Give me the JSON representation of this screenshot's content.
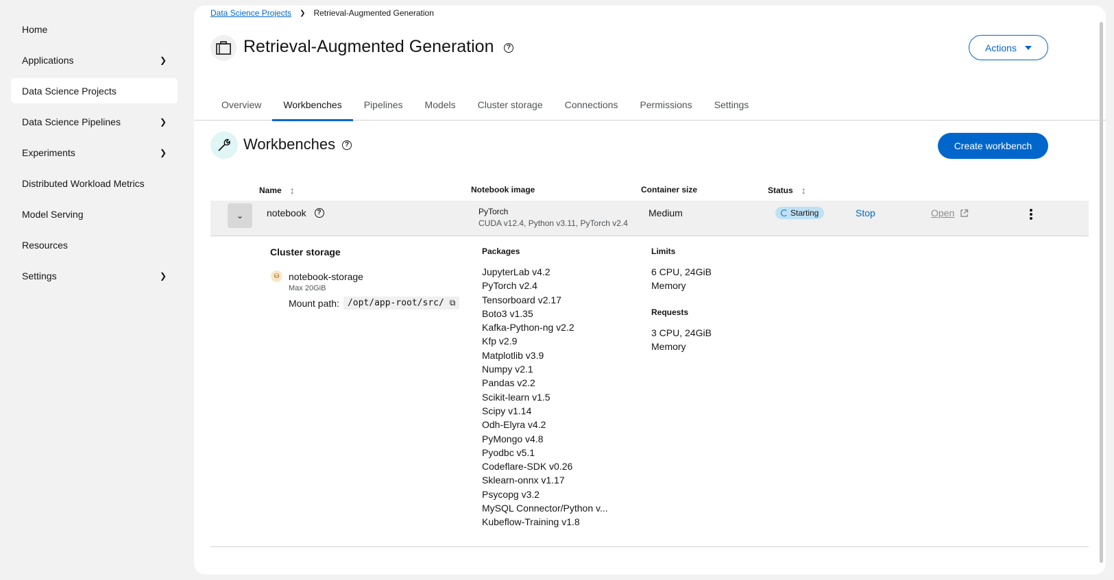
{
  "sidebar": {
    "items": [
      {
        "label": "Home",
        "chevron": false,
        "active": false
      },
      {
        "label": "Applications",
        "chevron": true,
        "active": false
      },
      {
        "label": "Data Science Projects",
        "chevron": false,
        "active": true
      },
      {
        "label": "Data Science Pipelines",
        "chevron": true,
        "active": false
      },
      {
        "label": "Experiments",
        "chevron": true,
        "active": false
      },
      {
        "label": "Distributed Workload Metrics",
        "chevron": false,
        "active": false
      },
      {
        "label": "Model Serving",
        "chevron": false,
        "active": false
      },
      {
        "label": "Resources",
        "chevron": false,
        "active": false
      },
      {
        "label": "Settings",
        "chevron": true,
        "active": false
      }
    ]
  },
  "breadcrumb": {
    "parent": "Data Science Projects",
    "current": "Retrieval-Augmented Generation"
  },
  "header": {
    "title": "Retrieval-Augmented Generation",
    "actions_label": "Actions"
  },
  "tabs": [
    {
      "label": "Overview",
      "active": false
    },
    {
      "label": "Workbenches",
      "active": true
    },
    {
      "label": "Pipelines",
      "active": false
    },
    {
      "label": "Models",
      "active": false
    },
    {
      "label": "Cluster storage",
      "active": false
    },
    {
      "label": "Connections",
      "active": false
    },
    {
      "label": "Permissions",
      "active": false
    },
    {
      "label": "Settings",
      "active": false
    }
  ],
  "section": {
    "title": "Workbenches",
    "create_label": "Create workbench"
  },
  "table": {
    "columns": {
      "name": "Name",
      "image": "Notebook image",
      "size": "Container size",
      "status": "Status"
    },
    "row": {
      "name": "notebook",
      "image_name": "PyTorch",
      "image_detail": "CUDA v12.4, Python v3.11, PyTorch v2.4",
      "size": "Medium",
      "status": "Starting",
      "stop_label": "Stop",
      "open_label": "Open"
    }
  },
  "expanded": {
    "cluster_storage_title": "Cluster storage",
    "storage_name": "notebook-storage",
    "storage_max": "Max 20GiB",
    "mount_label": "Mount path:",
    "mount_path": "/opt/app-root/src/",
    "packages_title": "Packages",
    "packages": [
      "JupyterLab v4.2",
      "PyTorch v2.4",
      "Tensorboard v2.17",
      "Boto3 v1.35",
      "Kafka-Python-ng v2.2",
      "Kfp v2.9",
      "Matplotlib v3.9",
      "Numpy v2.1",
      "Pandas v2.2",
      "Scikit-learn v1.5",
      "Scipy v1.14",
      "Odh-Elyra v4.2",
      "PyMongo v4.8",
      "Pyodbc v5.1",
      "Codeflare-SDK v0.26",
      "Sklearn-onnx v1.17",
      "Psycopg v3.2",
      "MySQL Connector/Python v...",
      "Kubeflow-Training v1.8"
    ],
    "limits_title": "Limits",
    "limits_line1": "6 CPU, 24GiB",
    "limits_line2": "Memory",
    "requests_title": "Requests",
    "requests_line1": "3 CPU, 24GiB",
    "requests_line2": "Memory"
  },
  "colors": {
    "accent": "#0066cc",
    "status_badge": "#bee1f4"
  }
}
